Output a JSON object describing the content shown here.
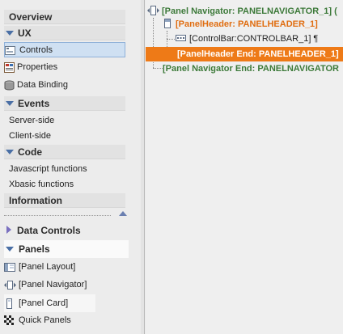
{
  "sidebar": {
    "overview": "Overview",
    "ux": {
      "title": "UX",
      "items": [
        {
          "label": "Controls",
          "icon": "controls-icon"
        },
        {
          "label": "Properties",
          "icon": "properties-icon"
        },
        {
          "label": "Data Binding",
          "icon": "database-icon"
        }
      ]
    },
    "events": {
      "title": "Events",
      "items": [
        {
          "label": "Server-side"
        },
        {
          "label": "Client-side"
        }
      ]
    },
    "code": {
      "title": "Code",
      "items": [
        {
          "label": "Javascript functions"
        },
        {
          "label": "Xbasic functions"
        }
      ]
    },
    "information": "Information",
    "data_controls": "Data Controls",
    "panels": {
      "title": "Panels",
      "items": [
        {
          "label": "[Panel Layout]",
          "icon": "panel-layout-icon"
        },
        {
          "label": "[Panel Navigator]",
          "icon": "panel-navigator-icon"
        },
        {
          "label": "[Panel Card]",
          "icon": "panel-card-icon"
        },
        {
          "label": "Quick Panels",
          "icon": "checkered-flag-icon"
        }
      ]
    }
  },
  "tree": {
    "nodes": [
      {
        "label": "[Panel Navigator: PANELNAVIGATOR_1] (",
        "style": "green",
        "icon": "panel-navigator-icon"
      },
      {
        "label": "[PanelHeader: PANELHEADER_1]",
        "style": "orange",
        "icon": "panel-header-icon"
      },
      {
        "label": "[ControlBar:CONTROLBAR_1] ¶",
        "style": "normal",
        "icon": "controlbar-icon"
      },
      {
        "label": "[PanelHeader End: PANELHEADER_1]",
        "style": "selected"
      },
      {
        "label": "[Panel Navigator End: PANELNAVIGATOR",
        "style": "green"
      }
    ]
  },
  "colors": {
    "selected_row": "#ee7a17",
    "green_text": "#3d7a3a",
    "orange_text": "#e06d10",
    "section_triangle": "#4a6fa5"
  }
}
